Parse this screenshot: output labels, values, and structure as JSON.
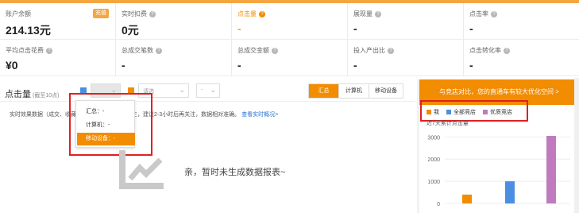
{
  "metrics": {
    "row1": [
      {
        "label": "账户余额",
        "value": "214.13元",
        "help": false,
        "button": "充值"
      },
      {
        "label": "实时扣费",
        "value": "0元",
        "help": true
      },
      {
        "label": "点击量",
        "value": "-",
        "help": true,
        "highlight": true
      },
      {
        "label": "展现量",
        "value": "-",
        "help": true
      },
      {
        "label": "点击率",
        "value": "-",
        "help": true
      }
    ],
    "row2": [
      {
        "label": "平均点击花费",
        "value": "¥0",
        "help": true
      },
      {
        "label": "总成交笔数",
        "value": "-",
        "help": true
      },
      {
        "label": "总成交金额",
        "value": "-",
        "help": true
      },
      {
        "label": "投入产出比",
        "value": "-",
        "help": true
      },
      {
        "label": "点击转化率",
        "value": "-",
        "help": true
      }
    ]
  },
  "section": {
    "title": "点击量",
    "subtitle": "(截至10点)",
    "dropdown1_value": "",
    "dropdown2_value": "",
    "dropdown3_value": "请选",
    "dropdown4_value": "-",
    "tabs": [
      "汇总",
      "计算机",
      "移动设备"
    ],
    "active_tab": "汇总"
  },
  "popup": {
    "items": [
      "汇总：-",
      "计算机：-",
      "移动设备：-"
    ],
    "selected": "移动设备：-"
  },
  "note": {
    "text": "实时效果数据（成交、收藏…数据）点击后持续产生，建议2-3小时后再关注，数据相对准确。",
    "link": "查看实时概况>"
  },
  "empty": {
    "text": "亲，暂时未生成数据报表~"
  },
  "right_panel": {
    "banner": "与竞店对比，您的直通车有较大优化空间 >",
    "chart_title": "近7天累计点击量"
  },
  "colors": {
    "accent": "#f28c00",
    "highlight_box": "#e02020",
    "series_me": "#f28c00",
    "series_all": "#4a8fe0",
    "series_best": "#c07bbf"
  },
  "chart_data": {
    "type": "bar",
    "categories": [
      "我",
      "全部竞店",
      "优质竞店"
    ],
    "series": [
      {
        "name": "我",
        "values": [
          400
        ]
      },
      {
        "name": "全部竞店",
        "values": [
          1000
        ]
      },
      {
        "name": "优质竞店",
        "values": [
          3050
        ]
      }
    ],
    "values": [
      400,
      1000,
      3050
    ],
    "title": "近7天累计点击量",
    "yticks": [
      "3000",
      "2000",
      "1000",
      "0"
    ],
    "ylim": [
      0,
      3300
    ],
    "grid": true,
    "legend": "top-left"
  }
}
